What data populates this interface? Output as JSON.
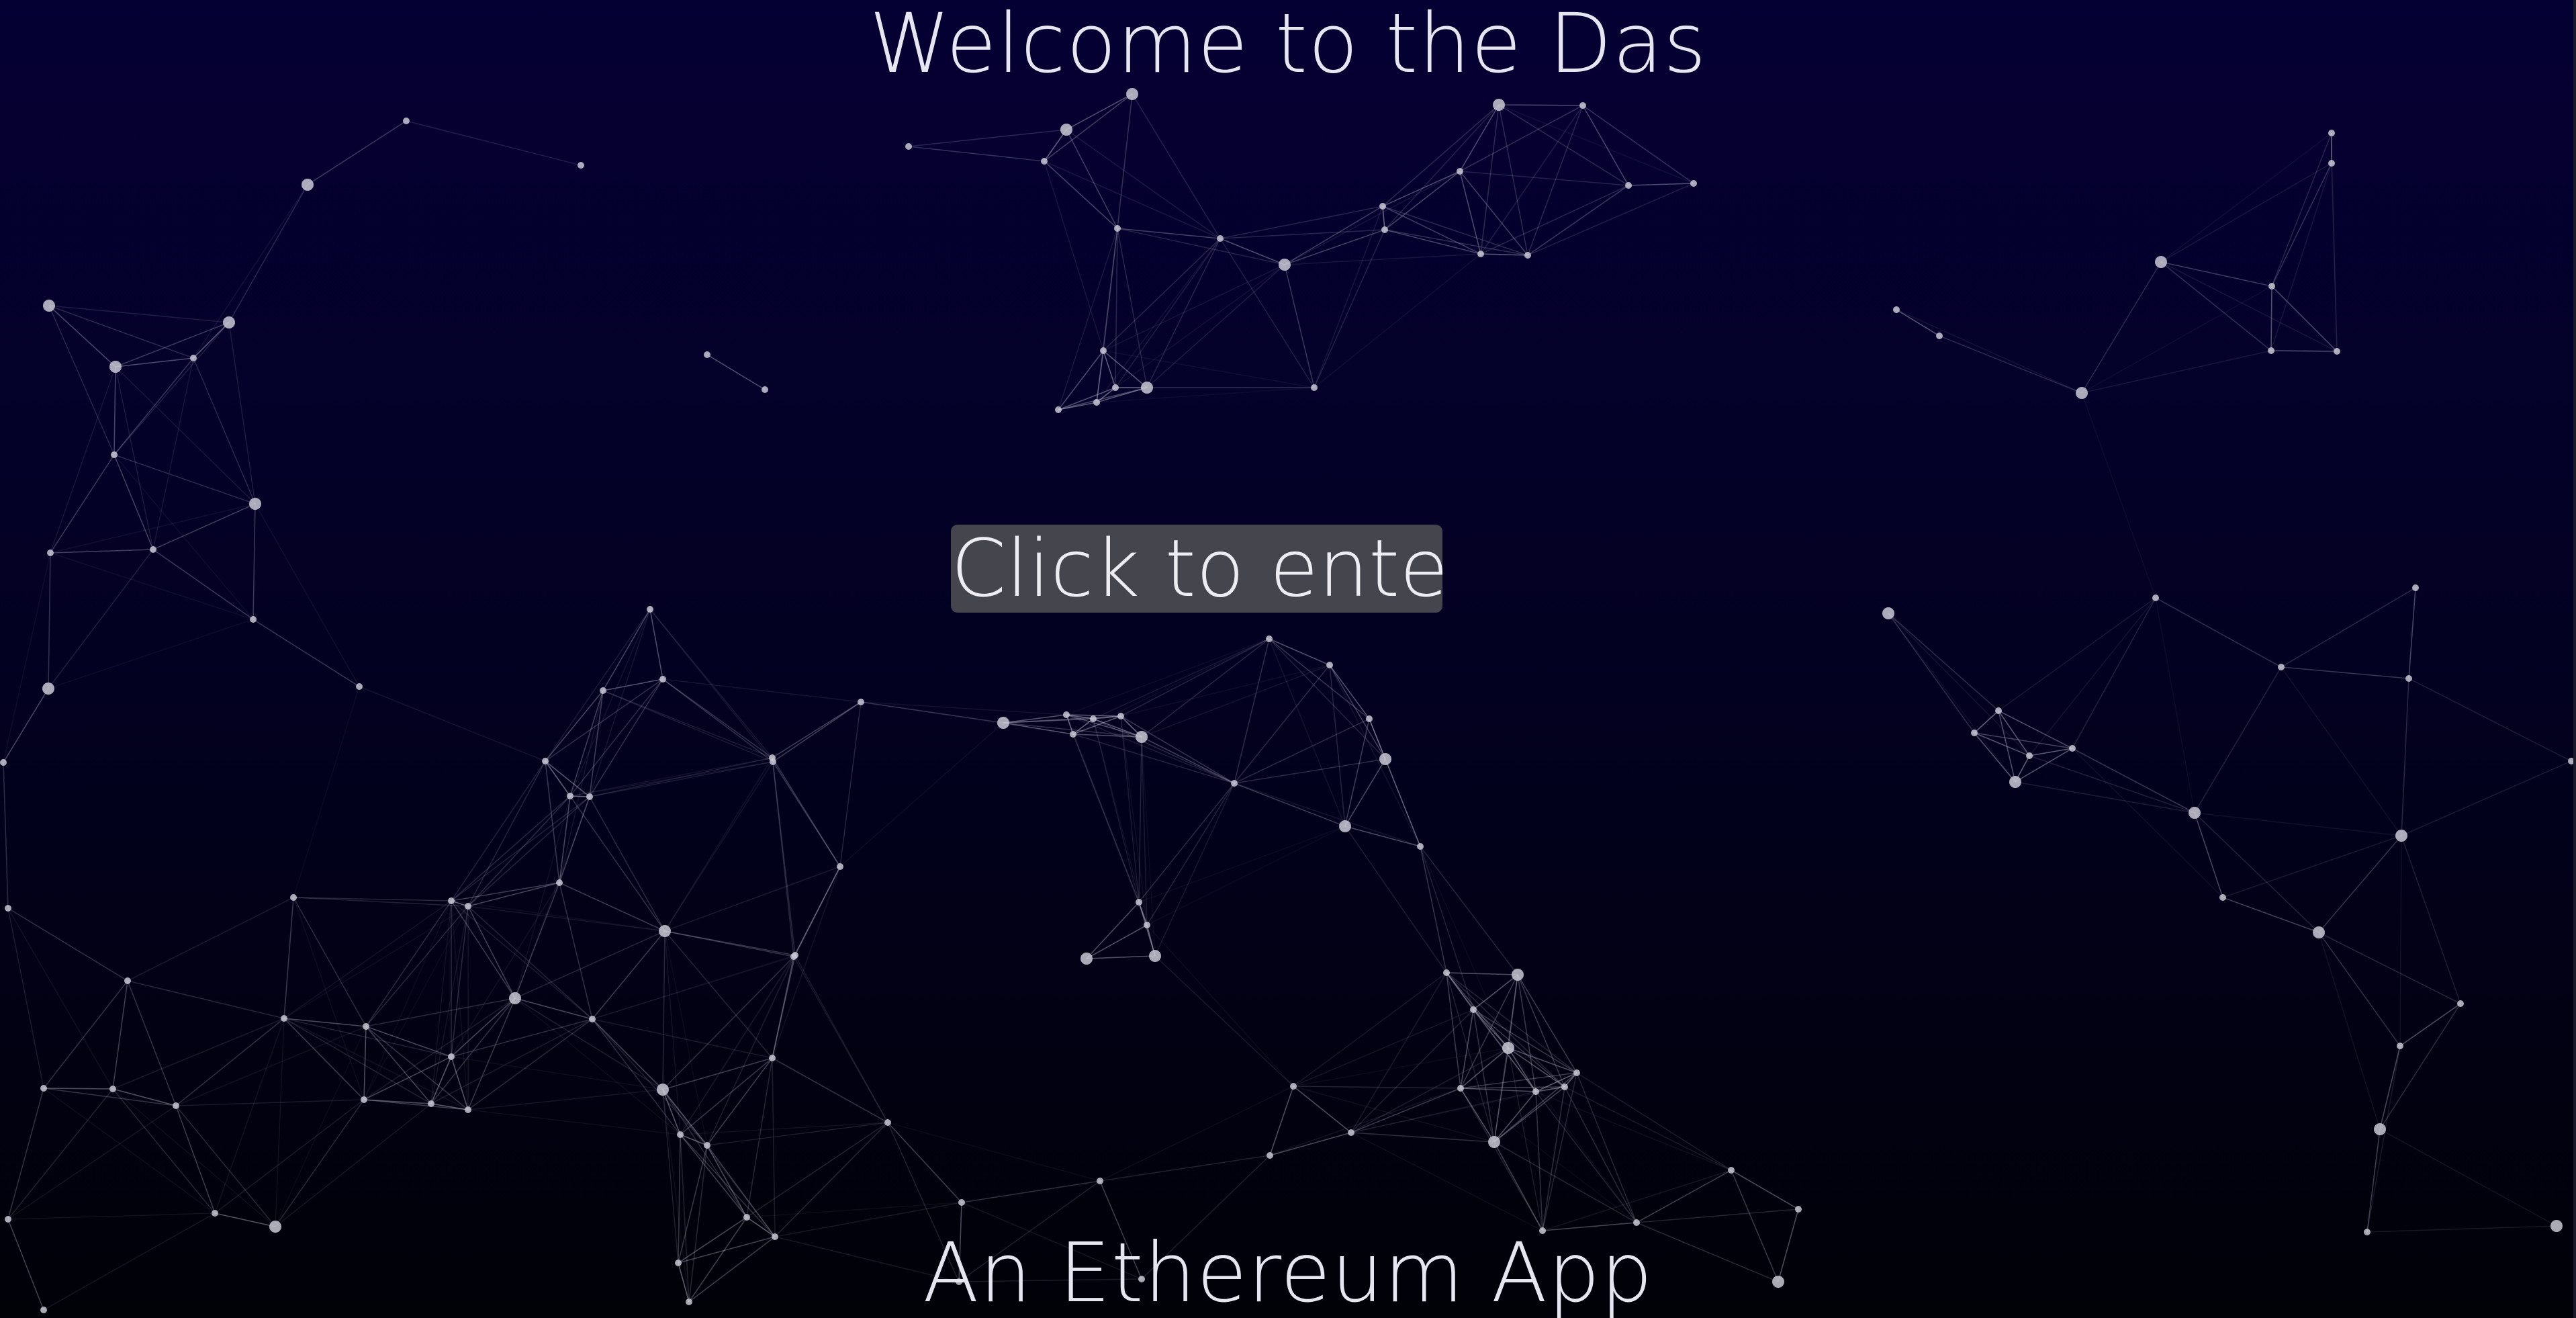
{
  "header": {
    "title": "Welcome to the Das"
  },
  "main": {
    "enter_button_label": "Click to enter"
  },
  "footer": {
    "subtitle": "An Ethereum App"
  },
  "background": {
    "effect": "particle-network",
    "gradient_top": "#050033",
    "gradient_bottom": "#010108",
    "particle_color": "#c8c8d4",
    "line_color": "#b4b4c8"
  }
}
